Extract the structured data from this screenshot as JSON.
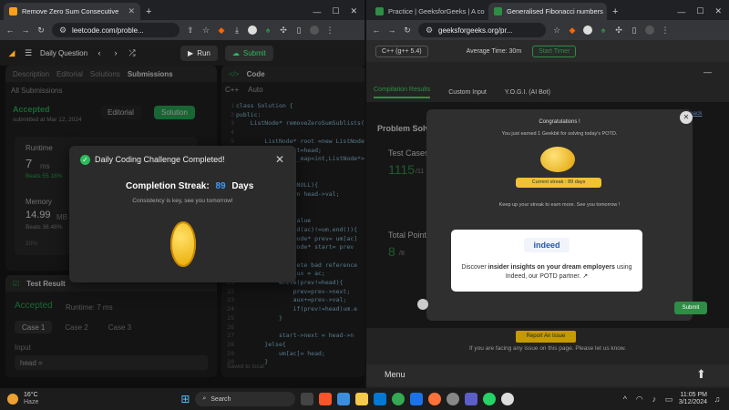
{
  "left_browser": {
    "tabs": [
      {
        "label": "Remove Zero Sum Consecutive",
        "active": true
      },
      {
        "label": "+",
        "active": false
      }
    ],
    "url": "leetcode.com/proble...",
    "toolbar": {
      "problem_list": "Daily Question",
      "run": "Run",
      "submit": "Submit"
    },
    "left_panel": {
      "tabs": [
        "Description",
        "Editorial",
        "Solutions",
        "Submissions"
      ],
      "all_submissions": "All Submissions",
      "status": "Accepted",
      "submitted": "submitted at Mar 12, 2024",
      "editorial_btn": "Editorial",
      "solution_btn": "Solution",
      "runtime_label": "Runtime",
      "runtime_value": "7",
      "runtime_unit": "ms",
      "beats": "Beats 55.18%",
      "memory_label": "Memory",
      "memory_value": "14.99",
      "memory_unit": "MB",
      "memory_beats": "Beats 36.48%",
      "percent_tick": "20%"
    },
    "test_result": {
      "title": "Test Result",
      "status": "Accepted",
      "runtime": "Runtime: 7 ms",
      "cases": [
        "Case 1",
        "Case 2",
        "Case 3"
      ],
      "input_label": "Input",
      "input_value": "head ="
    },
    "code_panel": {
      "title": "Code",
      "language": "C++",
      "auto": "Auto",
      "saved": "Saved to local",
      "lines": [
        "class Solution {",
        "public:",
        "    ListNode* removeZeroSumSublists(Li",
        "",
        "        ListNode* root =new ListNode(",
        "        root->next=head;",
        "        unordered_map<int,ListNode*> m",
        "        int ac=0;",
        "",
        "        if(head==NULL){",
        "            return head->val;",
        "        }",
        "",
        "        //found value",
        "        if(mp.find(ac)!=um.end()){",
        "            ListNode* prev= um[ac]",
        "            ListNode* start= prev",
        "",
        "            //delete bad reference",
        "            int aux = ac;",
        "            while(prev!=head){",
        "                prev=prev->next;",
        "                aux+=prev->val;",
        "                if(prev!=head)um.e",
        "            }",
        "",
        "            start->next = head->n",
        "        }else{",
        "            um[ac]= head;",
        "        }"
      ]
    },
    "modal": {
      "title": "Daily Coding Challenge Completed!",
      "streak_label": "Completion Streak:",
      "streak_value": "89",
      "streak_unit": "Days",
      "message": "Consistency is key, see you tomorrow!"
    }
  },
  "right_browser": {
    "tabs": [
      {
        "label": "Practice | GeeksforGeeks | A co",
        "active": false
      },
      {
        "label": "Generalised Fibonacci numbers",
        "active": true
      }
    ],
    "url": "geeksforgeeks.org/pr...",
    "top": {
      "language": "C++ (g++ 5.4)",
      "avg_time": "Average Time: 30m",
      "start_timer": "Start Timer"
    },
    "tabs_bar": [
      "Compilation Results",
      "Custom Input",
      "Y.O.G.I. (AI Bot)"
    ],
    "feedback": "Feedback",
    "problem_solved": "Problem Solv",
    "test_cases": "Test Cases",
    "test_cases_value": "1115",
    "test_cases_total": "/11",
    "total_points": "Total Point",
    "total_points_value": "8",
    "total_points_total": "/8",
    "modal": {
      "congrats": "Congratulations !",
      "earned": "You just earned 1 Geekbit for solving today's POTD.",
      "streak_badge": "Current streak : 89 days",
      "keep_up": "Keep up your streak to earn more. See you tomorrow !",
      "indeed_logo": "indeed",
      "discover_pre": "Discover ",
      "discover_bold": "insider insights on your dream employers",
      "discover_post": " using Indeed, our POTD partner.",
      "submit": "Submit"
    },
    "report_issue": "Report An Issue",
    "report_text": "If you are facing any issue on this page. Please let us know.",
    "menu": "Menu"
  },
  "taskbar": {
    "weather_temp": "16°C",
    "weather_desc": "Haze",
    "search": "Search",
    "time": "11:05 PM",
    "date": "3/12/2024"
  }
}
